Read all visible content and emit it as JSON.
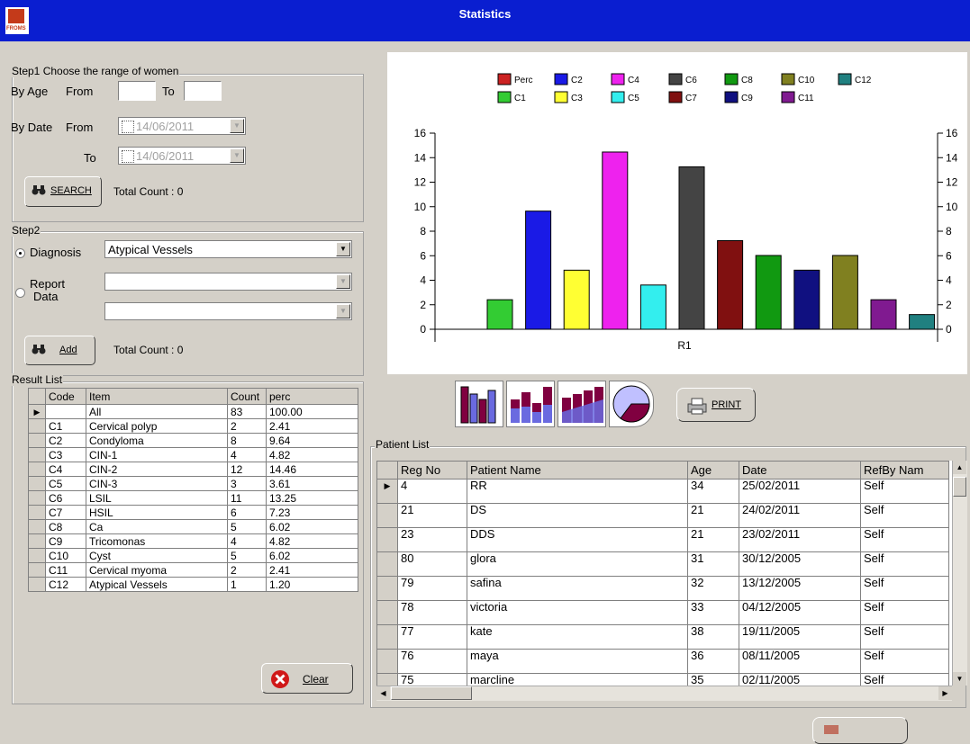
{
  "window": {
    "title": "Statistics",
    "logo_text": "FROMS"
  },
  "step1": {
    "title": "Step1 Choose the range of women",
    "by_age_label": "By Age",
    "from_label": "From",
    "to_label": "To",
    "by_date_label": "By Date",
    "date_from_label": "From",
    "date_to_label": "To",
    "date_from_value": "14/06/2011",
    "date_to_value": "14/06/2011",
    "search_label": "SEARCH",
    "total_count": "Total Count : 0"
  },
  "step2": {
    "title": "Step2",
    "diagnosis_label": "Diagnosis",
    "diagnosis_value": "Atypical Vessels",
    "report_label_1": "Report",
    "report_label_2": "Data",
    "add_label": "Add",
    "total_count": "Total Count : 0"
  },
  "result_list": {
    "title": "Result List",
    "columns": [
      "Code",
      "Item",
      "Count",
      "perc"
    ],
    "rows": [
      {
        "code": "",
        "item": "All",
        "count": "83",
        "perc": "100.00"
      },
      {
        "code": "C1",
        "item": "Cervical polyp",
        "count": "2",
        "perc": "2.41"
      },
      {
        "code": "C2",
        "item": "Condyloma",
        "count": "8",
        "perc": "9.64"
      },
      {
        "code": "C3",
        "item": "CIN-1",
        "count": "4",
        "perc": "4.82"
      },
      {
        "code": "C4",
        "item": "CIN-2",
        "count": "12",
        "perc": "14.46"
      },
      {
        "code": "C5",
        "item": "CIN-3",
        "count": "3",
        "perc": "3.61"
      },
      {
        "code": "C6",
        "item": "LSIL",
        "count": "11",
        "perc": "13.25"
      },
      {
        "code": "C7",
        "item": "HSIL",
        "count": "6",
        "perc": "7.23"
      },
      {
        "code": "C8",
        "item": "Ca",
        "count": "5",
        "perc": "6.02"
      },
      {
        "code": "C9",
        "item": "Tricomonas",
        "count": "4",
        "perc": "4.82"
      },
      {
        "code": "C10",
        "item": "Cyst",
        "count": "5",
        "perc": "6.02"
      },
      {
        "code": "C11",
        "item": "Cervical myoma",
        "count": "2",
        "perc": "2.41"
      },
      {
        "code": "C12",
        "item": "Atypical Vessels",
        "count": "1",
        "perc": "1.20"
      }
    ],
    "clear_label": "Clear"
  },
  "print_label": "PRINT",
  "patient_list": {
    "title": "Patient List",
    "columns": [
      "Reg No",
      "Patient Name",
      "Age",
      "Date",
      "RefBy Nam"
    ],
    "rows": [
      {
        "reg": "4",
        "name": "RR",
        "age": "34",
        "date": "25/02/2011",
        "ref": "Self"
      },
      {
        "reg": "21",
        "name": "DS",
        "age": "21",
        "date": "24/02/2011",
        "ref": "Self"
      },
      {
        "reg": "23",
        "name": "DDS",
        "age": "21",
        "date": "23/02/2011",
        "ref": "Self"
      },
      {
        "reg": "80",
        "name": "glora",
        "age": "31",
        "date": "30/12/2005",
        "ref": "Self"
      },
      {
        "reg": "79",
        "name": "safina",
        "age": "32",
        "date": "13/12/2005",
        "ref": "Self"
      },
      {
        "reg": "78",
        "name": "victoria",
        "age": "33",
        "date": "04/12/2005",
        "ref": "Self"
      },
      {
        "reg": "77",
        "name": "kate",
        "age": "38",
        "date": "19/11/2005",
        "ref": "Self"
      },
      {
        "reg": "76",
        "name": "maya",
        "age": "36",
        "date": "08/11/2005",
        "ref": "Self"
      },
      {
        "reg": "75",
        "name": "marcline",
        "age": "35",
        "date": "02/11/2005",
        "ref": "Self"
      }
    ]
  },
  "chart_data": {
    "type": "bar",
    "categories": [
      "R1"
    ],
    "ylim": [
      0,
      16
    ],
    "yticks": [
      0,
      2,
      4,
      6,
      8,
      10,
      12,
      14,
      16
    ],
    "grid": false,
    "legend_position": "top",
    "series": [
      {
        "name": "Perc",
        "color": "#cc2222",
        "values": [
          null
        ]
      },
      {
        "name": "C1",
        "color": "#33cc33",
        "values": [
          2.41
        ]
      },
      {
        "name": "C2",
        "color": "#1a1ae6",
        "values": [
          9.64
        ]
      },
      {
        "name": "C3",
        "color": "#ffff33",
        "values": [
          4.82
        ]
      },
      {
        "name": "C4",
        "color": "#ee22ee",
        "values": [
          14.46
        ]
      },
      {
        "name": "C5",
        "color": "#33eeee",
        "values": [
          3.61
        ]
      },
      {
        "name": "C6",
        "color": "#444444",
        "values": [
          13.25
        ]
      },
      {
        "name": "C7",
        "color": "#801010",
        "values": [
          7.23
        ]
      },
      {
        "name": "C8",
        "color": "#119911",
        "values": [
          6.02
        ]
      },
      {
        "name": "C9",
        "color": "#101080",
        "values": [
          4.82
        ]
      },
      {
        "name": "C10",
        "color": "#808020",
        "values": [
          6.02
        ]
      },
      {
        "name": "C11",
        "color": "#801a90",
        "values": [
          2.41
        ]
      },
      {
        "name": "C12",
        "color": "#208080",
        "values": [
          1.2
        ]
      }
    ]
  }
}
